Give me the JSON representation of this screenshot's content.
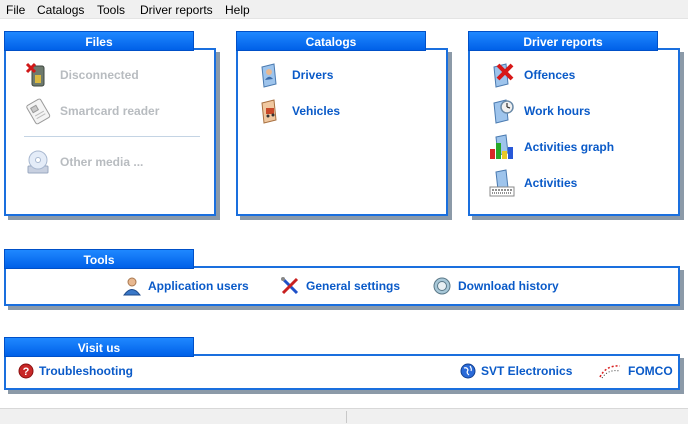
{
  "menu": {
    "file": "File",
    "catalogs": "Catalogs",
    "tools": "Tools",
    "driver_reports": "Driver reports",
    "help": "Help"
  },
  "files_panel": {
    "title": "Files",
    "disconnected": "Disconnected",
    "smartcard_reader": "Smartcard reader",
    "other_media": "Other media ..."
  },
  "catalogs_panel": {
    "title": "Catalogs",
    "drivers": "Drivers",
    "vehicles": "Vehicles"
  },
  "driver_reports_panel": {
    "title": "Driver reports",
    "offences": "Offences",
    "work_hours": "Work hours",
    "activities_graph": "Activities graph",
    "activities": "Activities"
  },
  "tools_panel": {
    "title": "Tools",
    "application_users": "Application users",
    "general_settings": "General settings",
    "download_history": "Download history"
  },
  "visit_panel": {
    "title": "Visit us",
    "troubleshooting": "Troubleshooting",
    "svt_electronics": "SVT Electronics",
    "fomco": "FOMCO"
  },
  "colors": {
    "accent": "#1a6fde",
    "link": "#0a5ac8",
    "disabled": "#b8bcc0"
  },
  "icons": {
    "disconnected": "usb-disconnected-icon",
    "smartcard": "smartcard-icon",
    "other_media": "cd-media-icon",
    "drivers": "driver-book-icon",
    "vehicles": "vehicle-book-icon",
    "offences": "offence-icon",
    "work_hours": "work-hours-icon",
    "activities_graph": "activities-graph-icon",
    "activities": "activities-icon",
    "users": "user-icon",
    "settings": "tools-icon",
    "history": "download-history-icon",
    "help": "help-icon",
    "globe": "globe-icon",
    "fomco": "fomco-icon"
  }
}
